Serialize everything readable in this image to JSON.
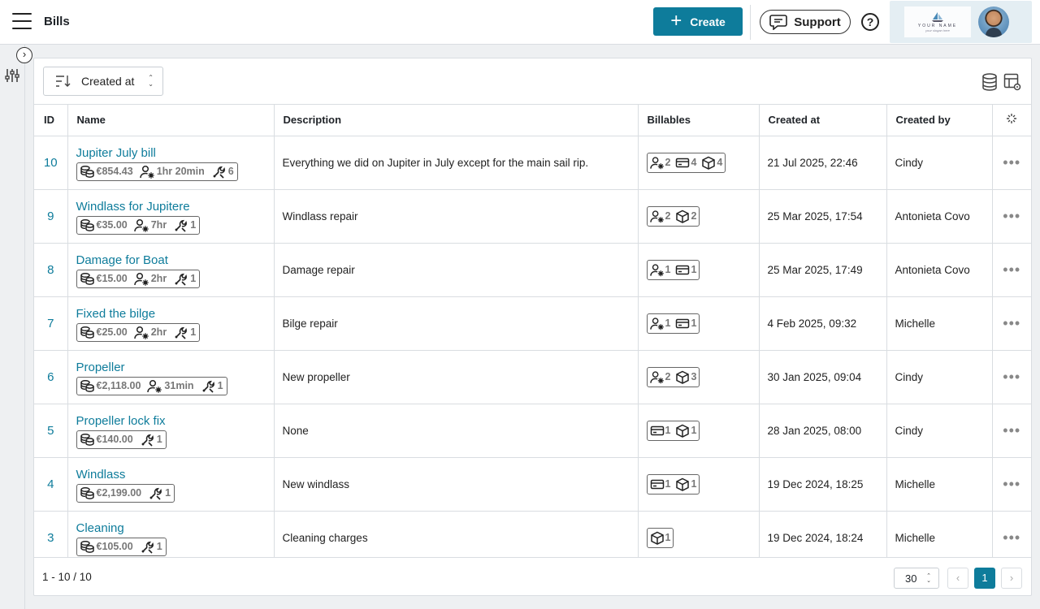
{
  "header": {
    "title": "Bills",
    "create_label": "Create",
    "support_label": "Support",
    "help_symbol": "?",
    "logo_text": "YOUR NAME",
    "logo_subtext": "your slogan here"
  },
  "toolbar": {
    "sort_label": "Created at"
  },
  "table": {
    "columns": {
      "id": "ID",
      "name": "Name",
      "description": "Description",
      "billables": "Billables",
      "created_at": "Created at",
      "created_by": "Created by"
    },
    "rows": [
      {
        "id": "10",
        "name": "Jupiter July bill",
        "amount": "€854.43",
        "time": "1hr 20min",
        "repairs": "6",
        "description": "Everything we did on Jupiter in July except for the main sail rip.",
        "billables": [
          {
            "icon": "person-gear-icon",
            "count": "2"
          },
          {
            "icon": "card-icon",
            "count": "4"
          },
          {
            "icon": "box-icon",
            "count": "4"
          }
        ],
        "created_at": "21 Jul 2025, 22:46",
        "created_by": "Cindy"
      },
      {
        "id": "9",
        "name": "Windlass for Jupitere",
        "amount": "€35.00",
        "time": "7hr",
        "repairs": "1",
        "description": "Windlass repair",
        "billables": [
          {
            "icon": "person-gear-icon",
            "count": "2"
          },
          {
            "icon": "box-icon",
            "count": "2"
          }
        ],
        "created_at": "25 Mar 2025, 17:54",
        "created_by": "Antonieta Covo"
      },
      {
        "id": "8",
        "name": "Damage for Boat",
        "amount": "€15.00",
        "time": "2hr",
        "repairs": "1",
        "description": "Damage repair",
        "billables": [
          {
            "icon": "person-gear-icon",
            "count": "1"
          },
          {
            "icon": "card-icon",
            "count": "1"
          }
        ],
        "created_at": "25 Mar 2025, 17:49",
        "created_by": "Antonieta Covo"
      },
      {
        "id": "7",
        "name": "Fixed the bilge",
        "amount": "€25.00",
        "time": "2hr",
        "repairs": "1",
        "description": "Bilge repair",
        "billables": [
          {
            "icon": "person-gear-icon",
            "count": "1"
          },
          {
            "icon": "card-icon",
            "count": "1"
          }
        ],
        "created_at": "4 Feb 2025, 09:32",
        "created_by": "Michelle"
      },
      {
        "id": "6",
        "name": "Propeller",
        "amount": "€2,118.00",
        "time": "31min",
        "repairs": "1",
        "description": "New propeller",
        "billables": [
          {
            "icon": "person-gear-icon",
            "count": "2"
          },
          {
            "icon": "box-icon",
            "count": "3"
          }
        ],
        "created_at": "30 Jan 2025, 09:04",
        "created_by": "Cindy"
      },
      {
        "id": "5",
        "name": "Propeller lock fix",
        "amount": "€140.00",
        "time": null,
        "repairs": "1",
        "description": "None",
        "billables": [
          {
            "icon": "card-icon",
            "count": "1"
          },
          {
            "icon": "box-icon",
            "count": "1"
          }
        ],
        "created_at": "28 Jan 2025, 08:00",
        "created_by": "Cindy"
      },
      {
        "id": "4",
        "name": "Windlass",
        "amount": "€2,199.00",
        "time": null,
        "repairs": "1",
        "description": "New windlass",
        "billables": [
          {
            "icon": "card-icon",
            "count": "1"
          },
          {
            "icon": "box-icon",
            "count": "1"
          }
        ],
        "created_at": "19 Dec 2024, 18:25",
        "created_by": "Michelle"
      },
      {
        "id": "3",
        "name": "Cleaning",
        "amount": "€105.00",
        "time": null,
        "repairs": "1",
        "description": "Cleaning charges",
        "billables": [
          {
            "icon": "box-icon",
            "count": "1"
          }
        ],
        "created_at": "19 Dec 2024, 18:24",
        "created_by": "Michelle"
      }
    ]
  },
  "footer": {
    "range": "1 - 10 / 10",
    "page_size": "30",
    "current_page": "1",
    "prev_symbol": "‹",
    "next_symbol": "›"
  },
  "colors": {
    "accent": "#0e7c9b",
    "border": "#d9dde1",
    "background": "#eef0f2"
  }
}
